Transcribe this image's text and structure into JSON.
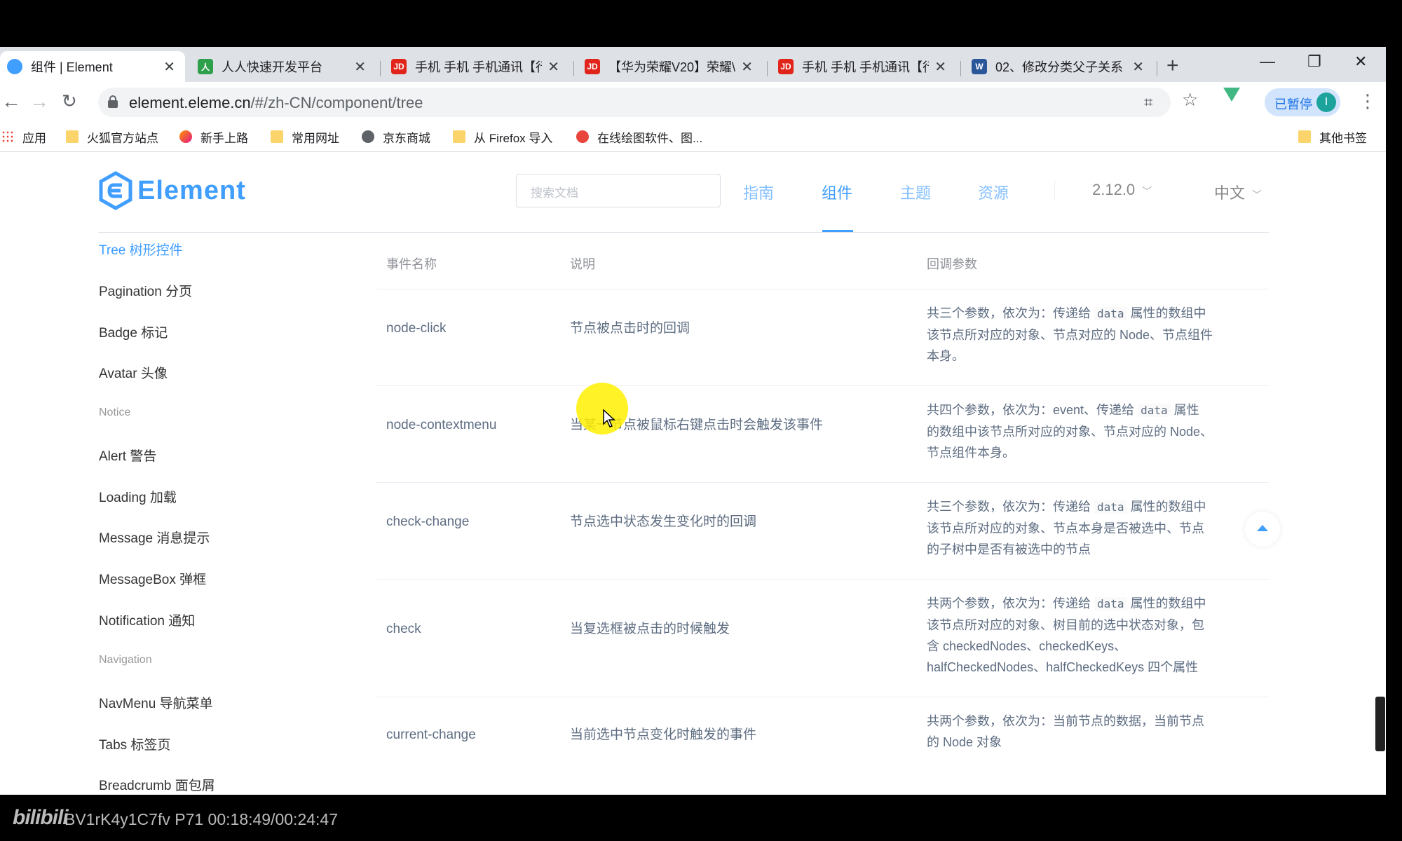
{
  "browser": {
    "tabs": [
      {
        "title": "组件 | Element",
        "icon": "element-favicon",
        "active": true
      },
      {
        "title": "人人快速开发平台",
        "icon": "renren-favicon",
        "active": false
      },
      {
        "title": "手机 手机 手机通讯【行",
        "icon": "jd-favicon",
        "active": false
      },
      {
        "title": "【华为荣耀V20】荣耀\\",
        "icon": "jd-favicon",
        "active": false
      },
      {
        "title": "手机 手机 手机通讯【行",
        "icon": "jd-favicon",
        "active": false
      },
      {
        "title": "02、修改分类父子关系",
        "icon": "word-favicon",
        "active": false
      }
    ],
    "url_host": "element.eleme.cn",
    "url_path": "/#/zh-CN/component/tree",
    "paused_label": "已暂停",
    "avatar_letter": "I",
    "bookmarks": [
      "应用",
      "火狐官方站点",
      "新手上路",
      "常用网址",
      "京东商城",
      "从 Firefox 导入",
      "在线绘图软件、图...",
      "其他书签"
    ]
  },
  "header": {
    "logo_text": "Element",
    "search_placeholder": "搜索文档",
    "nav": [
      "指南",
      "组件",
      "主题",
      "资源"
    ],
    "version": "2.12.0",
    "language": "中文"
  },
  "sidebar": {
    "items": [
      "Tree 树形控件",
      "Pagination 分页",
      "Badge 标记",
      "Avatar 头像",
      "Alert 警告",
      "Loading 加载",
      "Message 消息提示",
      "MessageBox 弹框",
      "Notification 通知",
      "NavMenu 导航菜单",
      "Tabs 标签页",
      "Breadcrumb 面包屑"
    ],
    "groups": [
      "Notice",
      "Navigation"
    ]
  },
  "table": {
    "headers": [
      "事件名称",
      "说明",
      "回调参数"
    ],
    "rows": [
      {
        "name": "node-click",
        "desc": "节点被点击时的回调",
        "p1": "共三个参数，依次为：传递给",
        "p2": "属性的数组中",
        "p3": "该节点所对应的对象、节点对应的 Node、节点组件",
        "p4": "本身。"
      },
      {
        "name": "node-contextmenu",
        "desc": "当某一节点被鼠标右键点击时会触发该事件",
        "p1": "共四个参数，依次为：event、传递给",
        "p2": "属性",
        "p3": "的数组中该节点所对应的对象、节点对应的 Node、",
        "p4": "节点组件本身。"
      },
      {
        "name": "check-change",
        "desc": "节点选中状态发生变化时的回调",
        "p1": "共三个参数，依次为：传递给",
        "p2": "属性的数组中",
        "p3": "该节点所对应的对象、节点本身是否被选中、节点",
        "p4": "的子树中是否有被选中的节点"
      },
      {
        "name": "check",
        "desc": "当复选框被点击的时候触发",
        "p1": "共两个参数，依次为：传递给",
        "p2": "属性的数组中",
        "p3": "该节点所对应的对象、树目前的选中状态对象，包",
        "p4": "含 checkedNodes、checkedKeys、",
        "p5": "halfCheckedNodes、halfCheckedKeys 四个属性"
      },
      {
        "name": "current-change",
        "desc": "当前选中节点变化时触发的事件",
        "p1": "共两个参数，依次为：当前节点的数据，当前节点",
        "p3": "的 Node 对象"
      }
    ],
    "code_word": "data"
  },
  "video_overlay": {
    "logo": "bilibili",
    "info": "BV1rK4y1C7fv P71 00:18:49/00:24:47"
  },
  "colors": {
    "accent": "#409eff",
    "text": "#5e6d82",
    "highlight": "#fff000"
  }
}
